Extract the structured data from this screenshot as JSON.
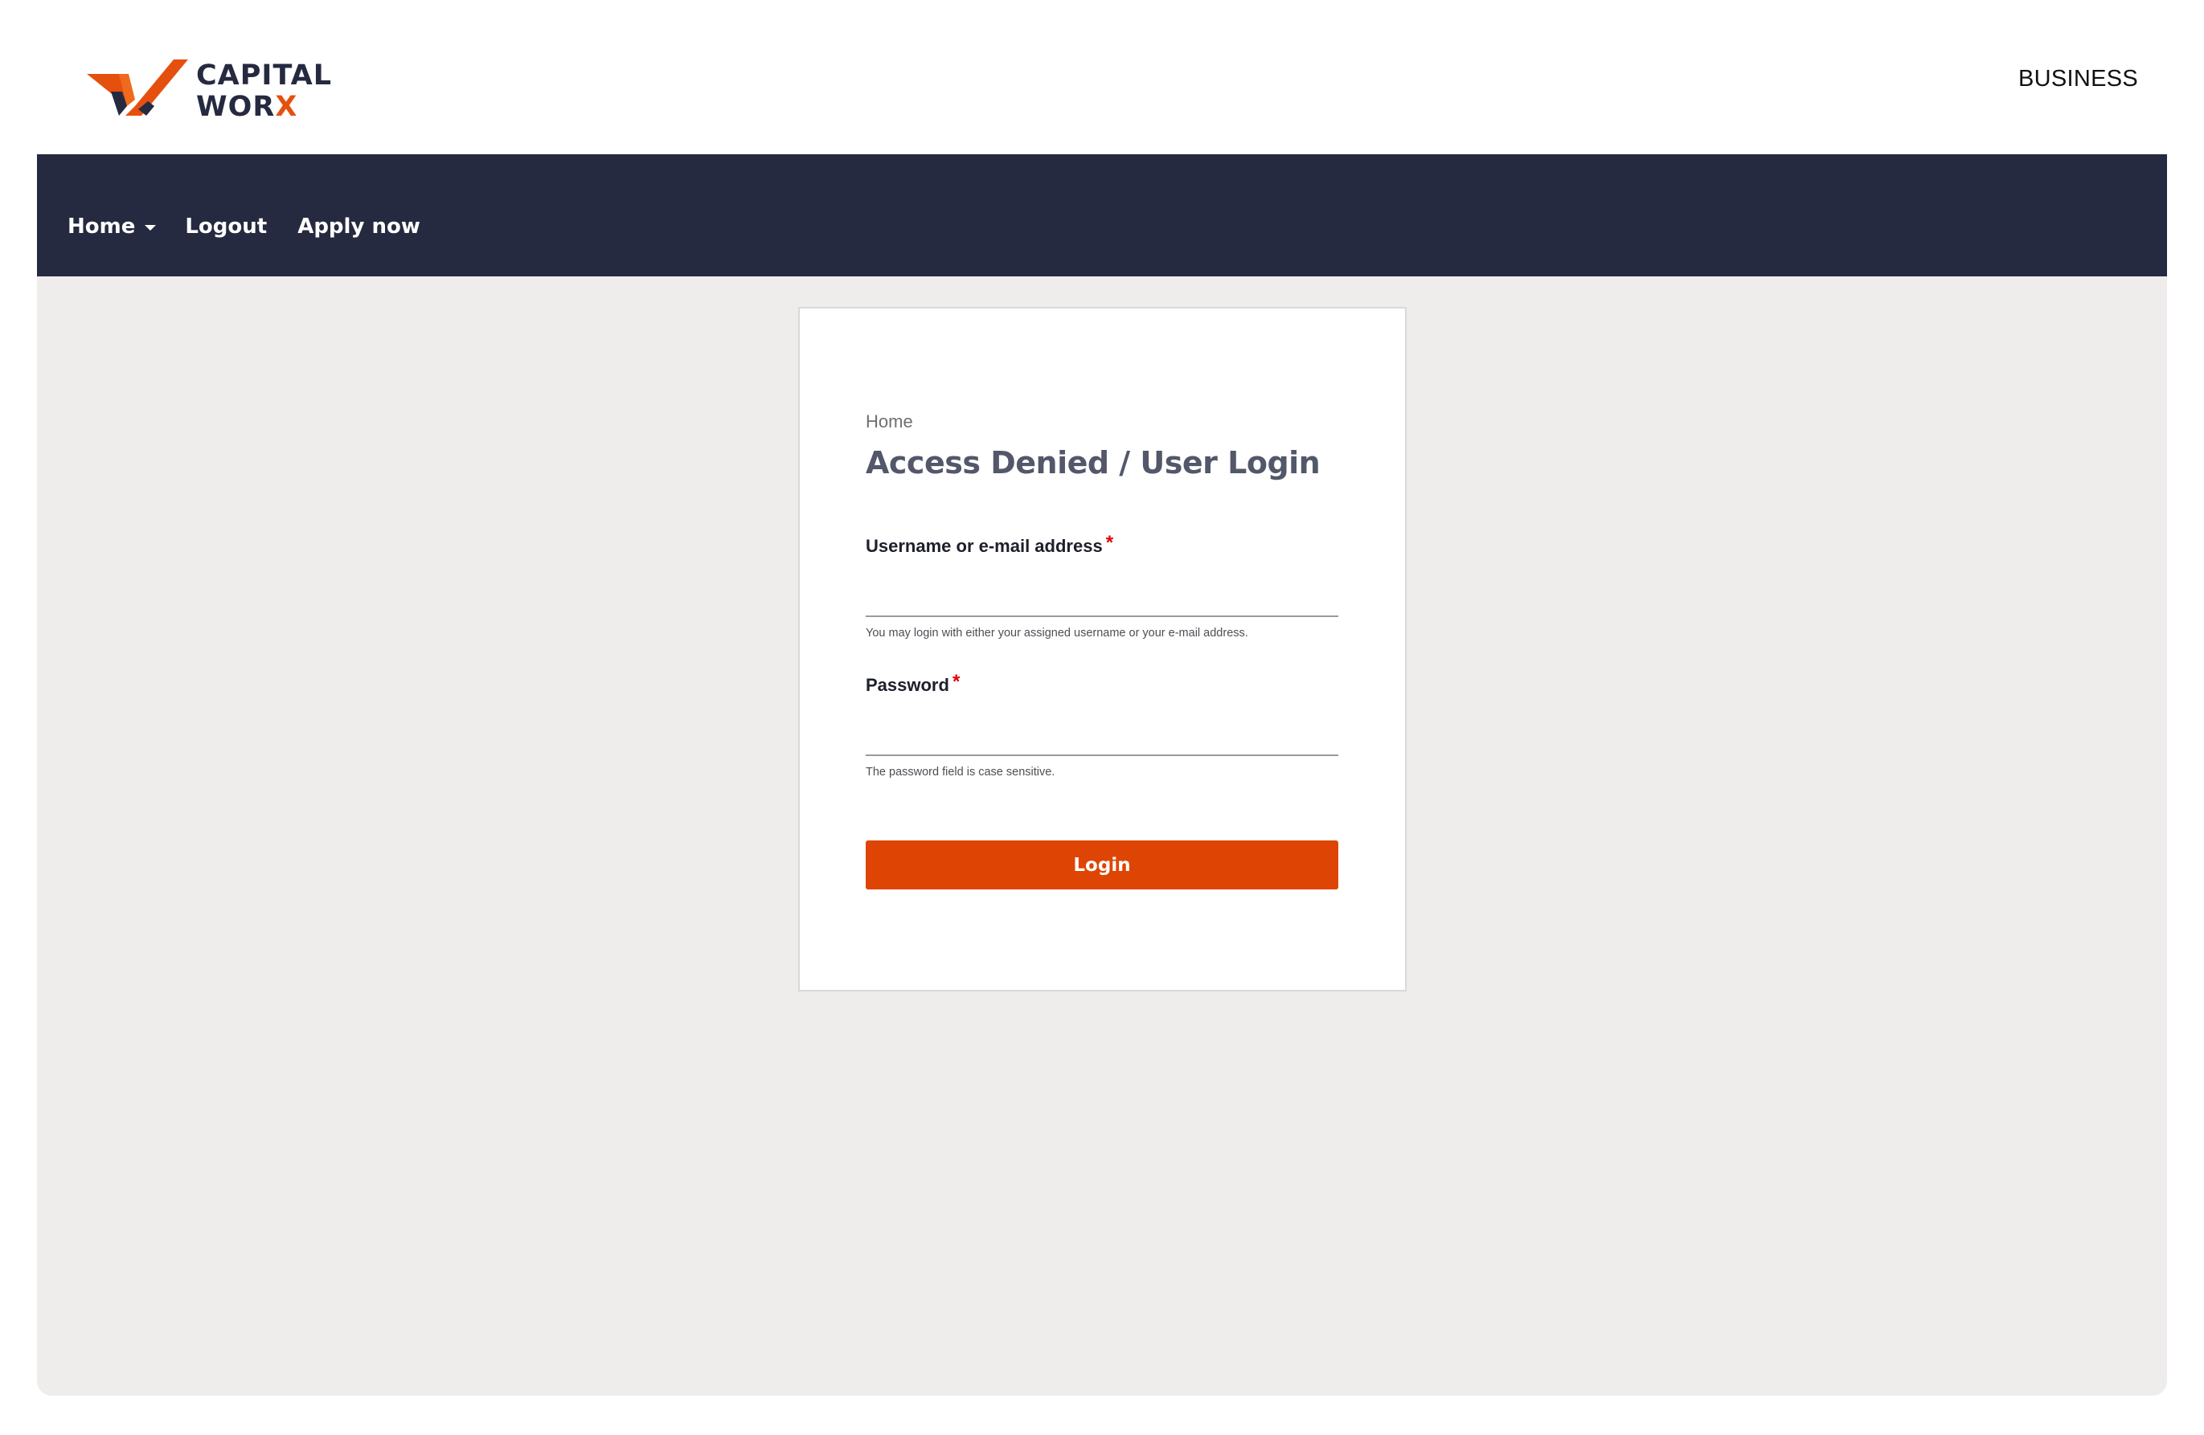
{
  "brand": {
    "logo_line1": "CAPITAL",
    "logo_line2_main": "WOR",
    "logo_line2_accent": "X",
    "primary_color": "#262a40",
    "accent_color": "#e5500f"
  },
  "header": {
    "business_link": "BUSINESS"
  },
  "nav": {
    "items": [
      {
        "label": "Home",
        "has_dropdown": true,
        "icon": "caret-down-icon"
      },
      {
        "label": "Logout"
      },
      {
        "label": "Apply now"
      }
    ],
    "background": "#262a40"
  },
  "main": {
    "background": "#eeedeb"
  },
  "login_form": {
    "breadcrumb": "Home",
    "title": "Access Denied / User Login",
    "username": {
      "label": "Username or e-mail address",
      "required_marker": "*",
      "value": "",
      "help": "You may login with either your assigned username or your e-mail address."
    },
    "password": {
      "label": "Password",
      "required_marker": "*",
      "value": "",
      "help": "The password field is case sensitive."
    },
    "submit_label": "Login",
    "submit_color": "#de4504"
  }
}
